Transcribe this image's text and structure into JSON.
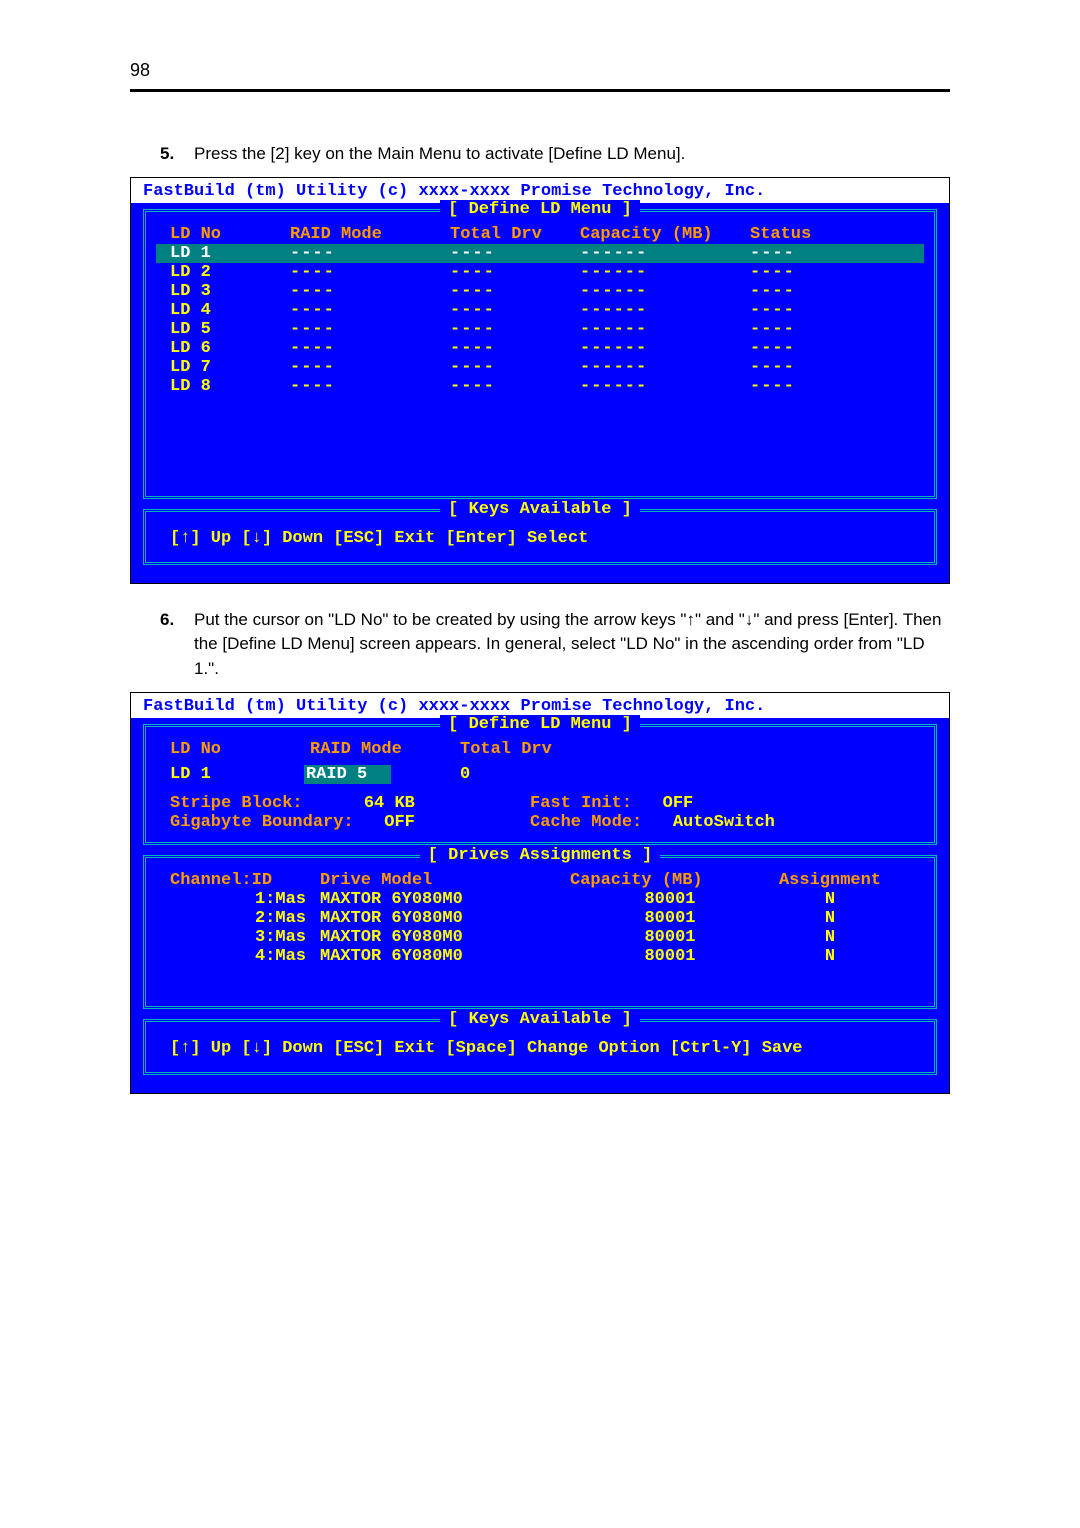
{
  "page_number": "98",
  "step5": {
    "num": "5.",
    "text": "Press the [2] key on the Main Menu to activate [Define LD Menu]."
  },
  "step6": {
    "num": "6.",
    "text": "Put the cursor on \"LD No\" to be created by using the arrow keys \"↑\" and \"↓\" and press [Enter]. Then the [Define LD Menu] screen appears. In general, select \"LD No\" in the ascending order from \"LD 1.\"."
  },
  "bios_title": "FastBuild (tm) Utility (c) xxxx-xxxx Promise Technology, Inc.",
  "panel1": {
    "title": "[ Define LD Menu ]",
    "headers": {
      "ld": "LD No",
      "raid": "RAID Mode",
      "tot": "Total Drv",
      "cap": "Capacity (MB)",
      "stat": "Status"
    },
    "rows": [
      {
        "ld": "LD  1",
        "raid": "----",
        "tot": "----",
        "cap": "------",
        "stat": "----",
        "sel": true
      },
      {
        "ld": "LD  2",
        "raid": "----",
        "tot": "----",
        "cap": "------",
        "stat": "----"
      },
      {
        "ld": "LD  3",
        "raid": "----",
        "tot": "----",
        "cap": "------",
        "stat": "----"
      },
      {
        "ld": "LD  4",
        "raid": "----",
        "tot": "----",
        "cap": "------",
        "stat": "----"
      },
      {
        "ld": "LD  5",
        "raid": "----",
        "tot": "----",
        "cap": "------",
        "stat": "----"
      },
      {
        "ld": "LD  6",
        "raid": "----",
        "tot": "----",
        "cap": "------",
        "stat": "----"
      },
      {
        "ld": "LD  7",
        "raid": "----",
        "tot": "----",
        "cap": "------",
        "stat": "----"
      },
      {
        "ld": "LD  8",
        "raid": "----",
        "tot": "----",
        "cap": "------",
        "stat": "----"
      }
    ],
    "keys_title": "[ Keys Available ]",
    "keys": "[↑] Up   [↓] Down   [ESC] Exit   [Enter] Select"
  },
  "panel2": {
    "title": "[ Define LD Menu ]",
    "head": {
      "ld": "LD No",
      "raid": "RAID Mode",
      "tot": "Total Drv"
    },
    "row": {
      "ld": "LD  1",
      "raid": "RAID 5",
      "tot": "0"
    },
    "opts": {
      "stripe_lbl": "Stripe Block:",
      "stripe_val": "64 KB",
      "gb_lbl": "Gigabyte Boundary:",
      "gb_val": "OFF",
      "fi_lbl": "Fast Init:",
      "fi_val": "OFF",
      "cm_lbl": "Cache Mode:",
      "cm_val": "AutoSwitch"
    },
    "drives_title": "[ Drives Assignments ]",
    "dhead": {
      "ch": "Channel:ID",
      "mod": "Drive Model",
      "cap": "Capacity (MB)",
      "asg": "Assignment"
    },
    "drows": [
      {
        "ch": "1:Mas",
        "mod": "MAXTOR 6Y080M0",
        "cap": "80001",
        "asg": "N"
      },
      {
        "ch": "2:Mas",
        "mod": "MAXTOR 6Y080M0",
        "cap": "80001",
        "asg": "N"
      },
      {
        "ch": "3:Mas",
        "mod": "MAXTOR 6Y080M0",
        "cap": "80001",
        "asg": "N"
      },
      {
        "ch": "4:Mas",
        "mod": "MAXTOR 6Y080M0",
        "cap": "80001",
        "asg": "N"
      }
    ],
    "keys_title": "[ Keys Available ]",
    "keys": "[↑] Up   [↓] Down   [ESC] Exit   [Space] Change Option   [Ctrl-Y] Save"
  }
}
